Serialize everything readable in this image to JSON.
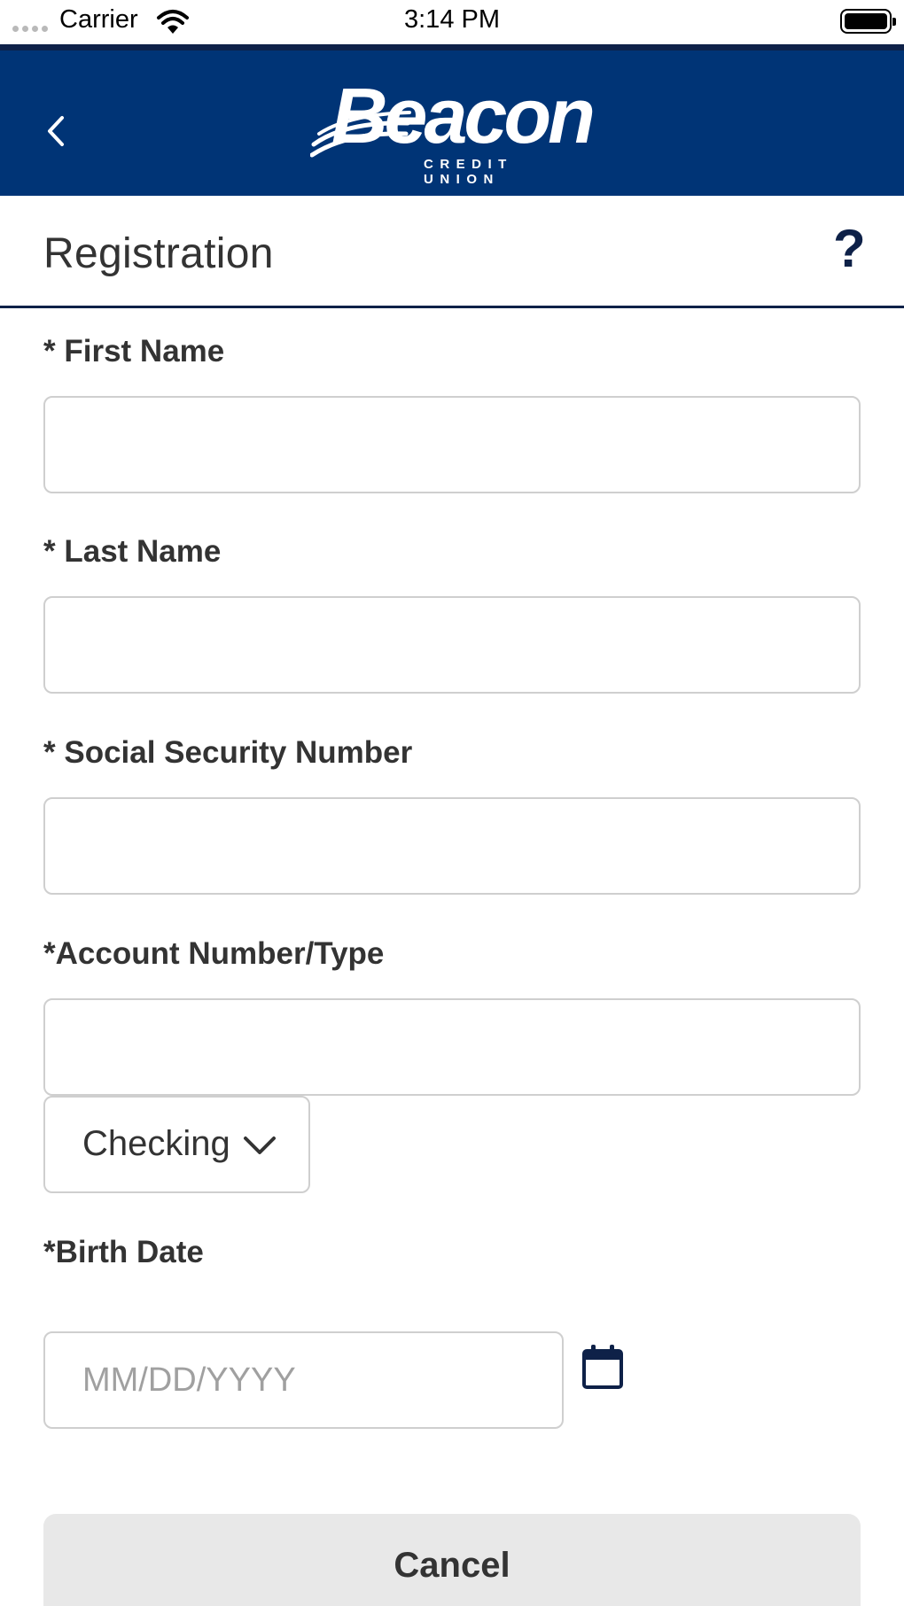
{
  "status_bar": {
    "carrier": "Carrier",
    "time": "3:14 PM"
  },
  "header": {
    "back_icon": "chevron-left-icon",
    "logo_name": "Beacon",
    "logo_subtitle": "CREDIT UNION",
    "background_color": "#003476"
  },
  "title_bar": {
    "title": "Registration",
    "help_label": "?"
  },
  "form": {
    "first_name": {
      "label": "* First Name",
      "value": ""
    },
    "last_name": {
      "label": "* Last Name",
      "value": ""
    },
    "ssn": {
      "label": "* Social Security Number",
      "value": ""
    },
    "account": {
      "label": "*Account Number/Type",
      "value": "",
      "type_selected": "Checking"
    },
    "birth_date": {
      "label": "*Birth Date",
      "value": "",
      "placeholder": "MM/DD/YYYY",
      "calendar_icon": "calendar-icon"
    }
  },
  "actions": {
    "cancel_label": "Cancel"
  }
}
